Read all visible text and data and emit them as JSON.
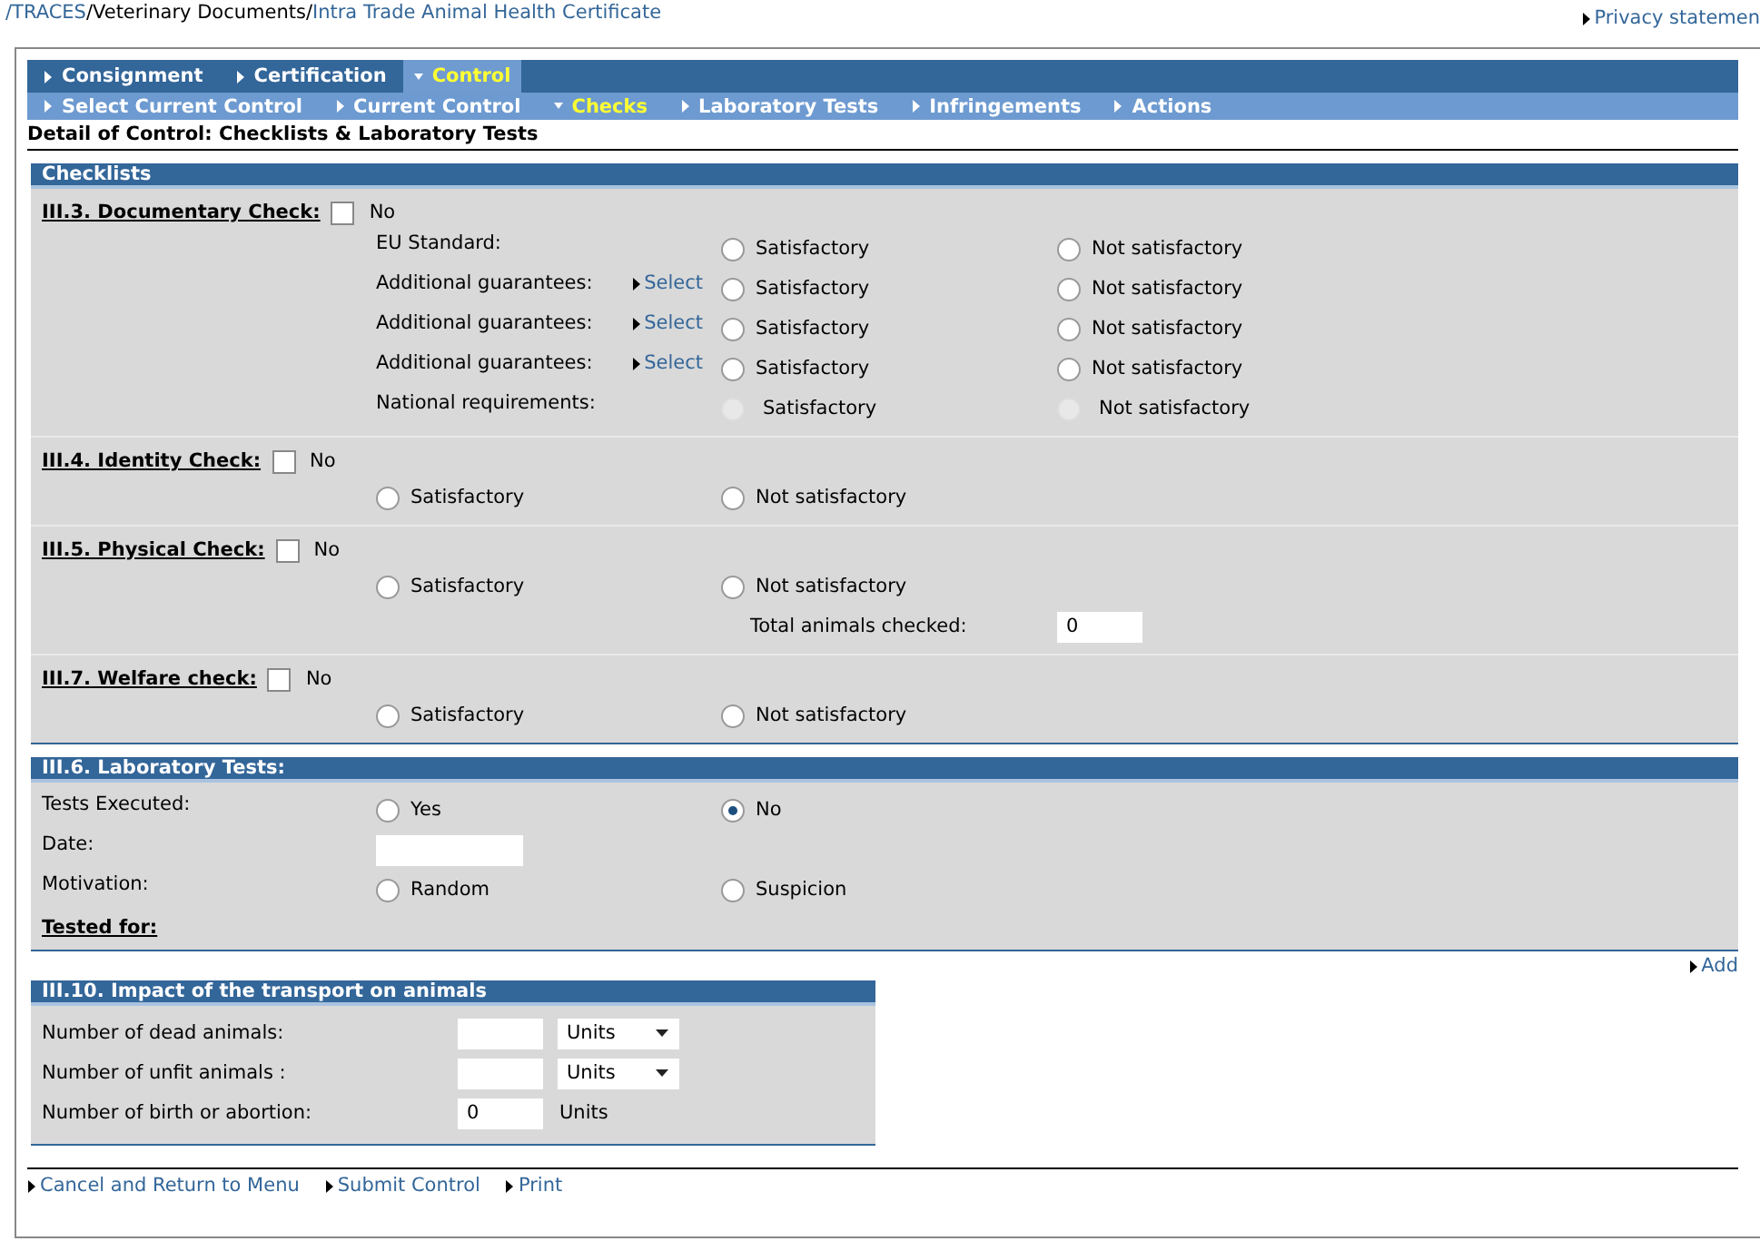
{
  "breadcrumb": [
    {
      "kind": "link",
      "text": "/TRACES"
    },
    {
      "kind": "text",
      "text": "/Veterinary Documents/"
    },
    {
      "kind": "link",
      "text": "Intra Trade Animal Health Certificate"
    }
  ],
  "privacy_link": "Privacy statemen",
  "menu_primary": [
    {
      "label": "Consignment",
      "selected": false
    },
    {
      "label": "Certification",
      "selected": false
    },
    {
      "label": "Control",
      "selected": true
    }
  ],
  "menu_secondary": [
    {
      "label": "Select Current Control",
      "selected": false
    },
    {
      "label": "Current Control",
      "selected": false
    },
    {
      "label": "Checks",
      "selected": true
    },
    {
      "label": "Laboratory Tests",
      "selected": false
    },
    {
      "label": "Infringements",
      "selected": false
    },
    {
      "label": "Actions",
      "selected": false
    }
  ],
  "page_heading": "Detail of Control: Checklists & Laboratory Tests",
  "checklists": {
    "title": "Checklists",
    "groups": [
      {
        "kind": "rows",
        "title": "III.3. Documentary Check:",
        "checkbox": {
          "label": "No",
          "checked": false
        },
        "rows": [
          {
            "label": "EU Standard:",
            "options": [
              {
                "label": "Satisfactory",
                "selected": false,
                "disabled": false
              },
              {
                "label": "Not satisfactory",
                "selected": false,
                "disabled": false
              }
            ]
          },
          {
            "label": "Additional guarantees:",
            "select_link": "Select",
            "options": [
              {
                "label": "Satisfactory",
                "selected": false,
                "disabled": false
              },
              {
                "label": "Not satisfactory",
                "selected": false,
                "disabled": false
              }
            ]
          },
          {
            "label": "Additional guarantees:",
            "select_link": "Select",
            "options": [
              {
                "label": "Satisfactory",
                "selected": false,
                "disabled": false
              },
              {
                "label": "Not satisfactory",
                "selected": false,
                "disabled": false
              }
            ]
          },
          {
            "label": "Additional guarantees:",
            "select_link": "Select",
            "options": [
              {
                "label": "Satisfactory",
                "selected": false,
                "disabled": false
              },
              {
                "label": "Not satisfactory",
                "selected": false,
                "disabled": false
              }
            ]
          },
          {
            "label": "National requirements:",
            "options": [
              {
                "label": "Satisfactory",
                "selected": false,
                "disabled": true
              },
              {
                "label": "Not satisfactory",
                "selected": false,
                "disabled": true
              }
            ]
          }
        ]
      },
      {
        "kind": "simple",
        "title": "III.4. Identity Check:",
        "checkbox": {
          "label": "No",
          "checked": false
        },
        "options": [
          {
            "label": "Satisfactory",
            "selected": false,
            "disabled": false
          },
          {
            "label": "Not satisfactory",
            "selected": false,
            "disabled": false
          }
        ]
      },
      {
        "kind": "simple",
        "title": "III.5. Physical Check:",
        "checkbox": {
          "label": "No",
          "checked": false
        },
        "options": [
          {
            "label": "Satisfactory",
            "selected": false,
            "disabled": false
          },
          {
            "label": "Not satisfactory",
            "selected": false,
            "disabled": false
          }
        ],
        "extra_field": {
          "label": "Total animals checked:",
          "value": "0"
        }
      },
      {
        "kind": "simple",
        "title": "III.7. Welfare check:",
        "checkbox": {
          "label": "No",
          "checked": false
        },
        "options": [
          {
            "label": "Satisfactory",
            "selected": false,
            "disabled": false
          },
          {
            "label": "Not satisfactory",
            "selected": false,
            "disabled": false
          }
        ]
      }
    ]
  },
  "laboratory": {
    "title": "III.6. Laboratory Tests:",
    "rows": [
      {
        "kind": "radio",
        "label": "Tests Executed:",
        "options": [
          {
            "label": "Yes",
            "selected": false,
            "disabled": false
          },
          {
            "label": "No",
            "selected": true,
            "disabled": false
          }
        ]
      },
      {
        "kind": "date",
        "label": "Date:"
      },
      {
        "kind": "radio",
        "label": "Motivation:",
        "options": [
          {
            "label": "Random",
            "selected": false,
            "disabled": false
          },
          {
            "label": "Suspicion",
            "selected": false,
            "disabled": false
          }
        ]
      }
    ],
    "tested_for": "Tested for:",
    "add_link": "Add"
  },
  "impact": {
    "title": "III.10. Impact of the transport on animals",
    "rows": [
      {
        "label": "Number of dead animals:",
        "unit": {
          "kind": "select",
          "text": "Units"
        }
      },
      {
        "label": "Number of unfit animals :",
        "unit": {
          "kind": "select",
          "text": "Units"
        }
      },
      {
        "label": "Number of birth or abortion:",
        "value": "0",
        "unit": {
          "kind": "text",
          "text": "Units"
        }
      }
    ]
  },
  "footer_links": [
    "Cancel and Return to Menu",
    "Submit Control",
    "Print"
  ]
}
